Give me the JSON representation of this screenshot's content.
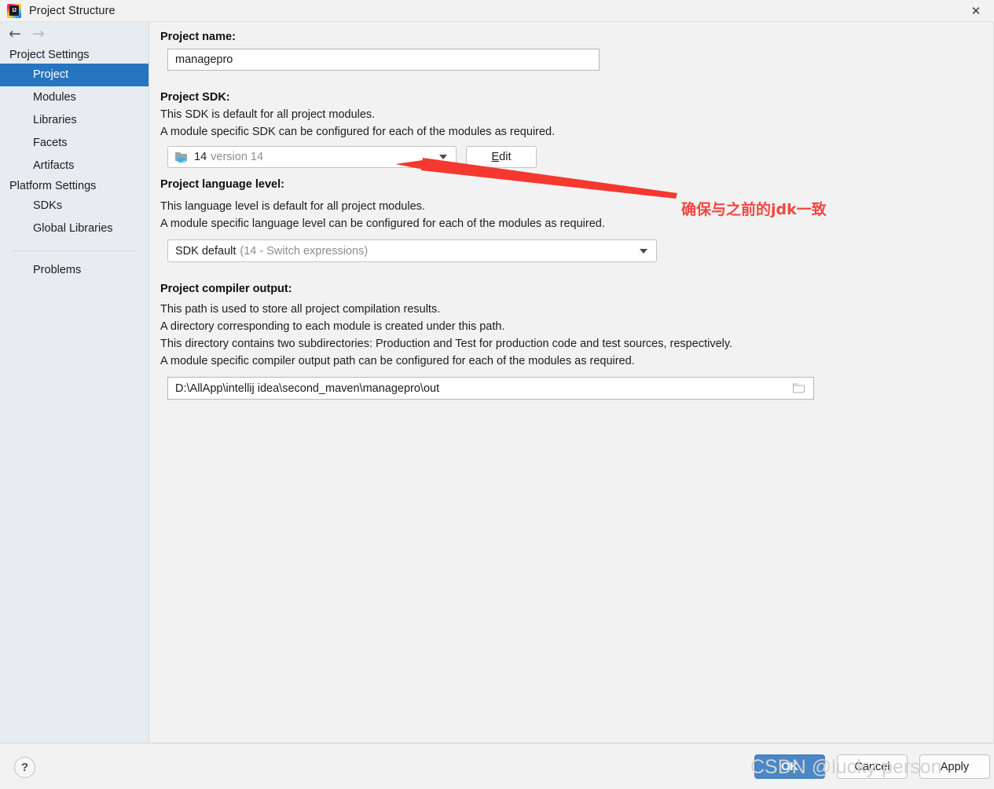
{
  "window": {
    "title": "Project Structure",
    "logo_icon": "intellij-idea-logo",
    "close_icon": "✕"
  },
  "nav": {
    "back_icon": "←",
    "forward_icon": "→"
  },
  "sidebar": {
    "groups": [
      {
        "label": "Project Settings",
        "items": [
          {
            "label": "Project",
            "selected": true
          },
          {
            "label": "Modules",
            "selected": false
          },
          {
            "label": "Libraries",
            "selected": false
          },
          {
            "label": "Facets",
            "selected": false
          },
          {
            "label": "Artifacts",
            "selected": false
          }
        ]
      },
      {
        "label": "Platform Settings",
        "items": [
          {
            "label": "SDKs",
            "selected": false
          },
          {
            "label": "Global Libraries",
            "selected": false
          }
        ]
      }
    ],
    "problems_label": "Problems"
  },
  "main": {
    "project_name": {
      "label": "Project name:",
      "value": "managepro"
    },
    "project_sdk": {
      "label": "Project SDK:",
      "desc1": "This SDK is default for all project modules.",
      "desc2": "A module specific SDK can be configured for each of the modules as required.",
      "value_main": "14",
      "value_detail": "version 14",
      "icon": "java-sdk-folder-icon",
      "edit_button_prefix": "E",
      "edit_button_suffix": "dit"
    },
    "language_level": {
      "label": "Project language level:",
      "desc1": "This language level is default for all project modules.",
      "desc2": "A module specific language level can be configured for each of the modules as required.",
      "value_main": "SDK default",
      "value_detail": "(14 - Switch expressions)"
    },
    "compiler_output": {
      "label": "Project compiler output:",
      "desc1": "This path is used to store all project compilation results.",
      "desc2": "A directory corresponding to each module is created under this path.",
      "desc3": "This directory contains two subdirectories: Production and Test for production code and test sources, respectively.",
      "desc4": "A module specific compiler output path can be configured for each of the modules as required.",
      "value": "D:\\AllApp\\intellij idea\\second_maven\\managepro\\out",
      "browse_icon": "folder-browse-icon"
    }
  },
  "annotation": {
    "text": "确保与之前的jdk一致",
    "color": "#f4463f",
    "arrow": "red-arrow-pointing-to-sdk-dropdown"
  },
  "footer": {
    "help_label": "?",
    "ok_label": "OK",
    "cancel_label": "Cancel",
    "apply_label": "Apply"
  },
  "watermark": {
    "text": "CSDN @lucky person"
  }
}
